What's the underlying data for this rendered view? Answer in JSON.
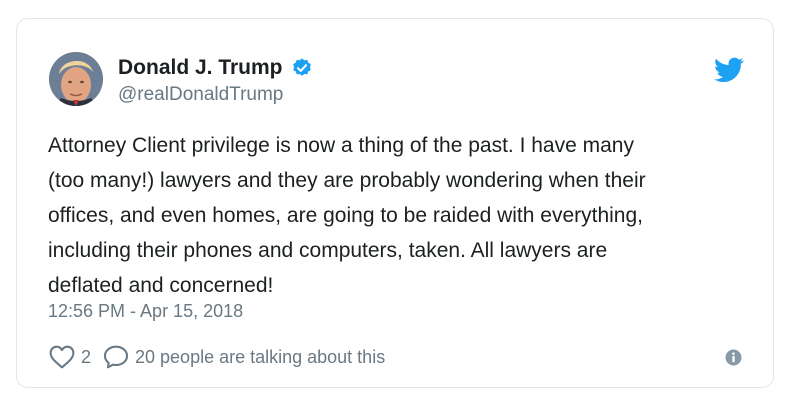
{
  "tweet": {
    "display_name": "Donald J. Trump",
    "handle": "@realDonaldTrump",
    "text": "Attorney Client privilege is now a thing of the past. I have many\n(too many!) lawyers and they are probably wondering when their\noffices, and even homes, are going to be raided with everything,\nincluding their phones and computers, taken. All lawyers are\ndeflated and concerned!",
    "timestamp": "12:56 PM - Apr 15, 2018",
    "likes_count": "2",
    "conversation_label": "20 people are talking about this"
  },
  "icons": {
    "verified": "verified-badge-icon",
    "brand": "twitter-bird-icon",
    "like": "heart-icon",
    "reply": "speech-bubble-icon",
    "info": "info-icon"
  },
  "colors": {
    "brand_blue": "#1da1f2",
    "text_primary": "#1c2022",
    "text_secondary": "#697882",
    "border": "#e1e8ed"
  }
}
